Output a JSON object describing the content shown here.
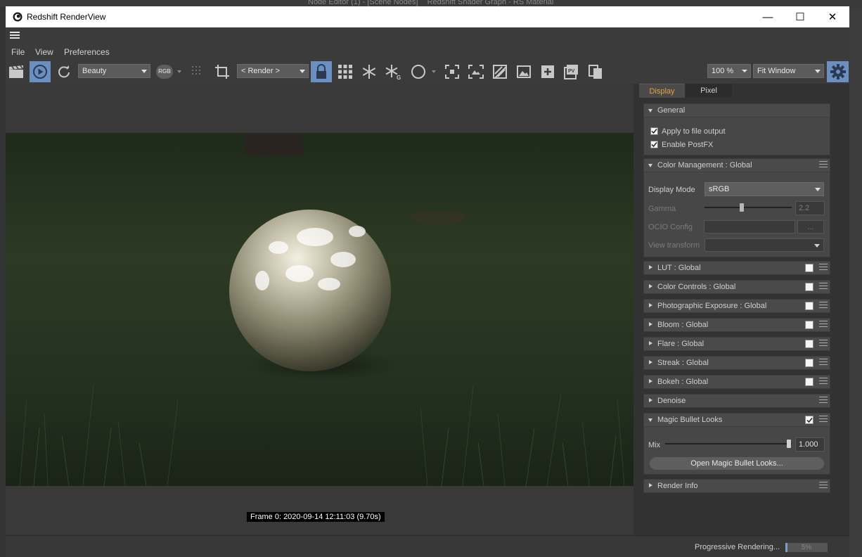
{
  "background": {
    "tabs": [
      "Node Editor (1) - [Scene Nodes]",
      "Redshift Shader Graph - RS Material"
    ]
  },
  "window": {
    "title": "Redshift RenderView",
    "controls": {
      "minimize": "—",
      "maximize": "☐",
      "close": "✕"
    }
  },
  "menu": {
    "items": [
      "File",
      "View",
      "Preferences"
    ]
  },
  "toolbar": {
    "aov_select": "Beauty",
    "channel_badge": "RGB",
    "camera_select": "< Render >",
    "zoom_value": "100 %",
    "fit_select": "Fit Window",
    "icons": [
      "clapboard-icon",
      "play-icon",
      "refresh-icon",
      "rgb-icon",
      "dots-grid-icon",
      "crop-icon",
      "lock-icon",
      "grid-icon",
      "snowflake-icon",
      "snowflake-g-icon",
      "circle-icon",
      "focus-icon",
      "frame-icon",
      "diagonal-icon",
      "image-icon",
      "add-image-icon",
      "pv-icon",
      "copy-icon",
      "gear-icon"
    ]
  },
  "viewport": {
    "frame_label": "Frame  0:  2020-09-14  12:11:03  (9.70s)"
  },
  "status": {
    "text": "Progressive Rendering...",
    "progress_label": "5%",
    "progress_fraction": 0.05
  },
  "panel": {
    "tabs": {
      "display": "Display",
      "pixel": "Pixel"
    },
    "general": {
      "title": "General",
      "apply_to_file": "Apply to file output",
      "enable_postfx": "Enable PostFX"
    },
    "color_management": {
      "title": "Color Management  : Global",
      "display_mode_label": "Display Mode",
      "display_mode_value": "sRGB",
      "gamma_label": "Gamma",
      "gamma_value": "2.2",
      "ocio_label": "OCIO Config",
      "ocio_button": "...",
      "view_transform_label": "View transform"
    },
    "sections": [
      {
        "title": "LUT  : Global"
      },
      {
        "title": "Color Controls  : Global"
      },
      {
        "title": "Photographic Exposure  : Global"
      },
      {
        "title": "Bloom  : Global"
      },
      {
        "title": "Flare  : Global"
      },
      {
        "title": "Streak  : Global"
      },
      {
        "title": "Bokeh  : Global"
      }
    ],
    "denoise": {
      "title": "Denoise"
    },
    "magic_bullet": {
      "title": "Magic Bullet Looks",
      "mix_label": "Mix",
      "mix_value": "1.000",
      "open_button": "Open Magic Bullet Looks..."
    },
    "render_info": {
      "title": "Render Info"
    }
  },
  "colors": {
    "accent": "#6c8fc2",
    "tab_active_text": "#e8a23a",
    "panel_bg": "#323232"
  }
}
